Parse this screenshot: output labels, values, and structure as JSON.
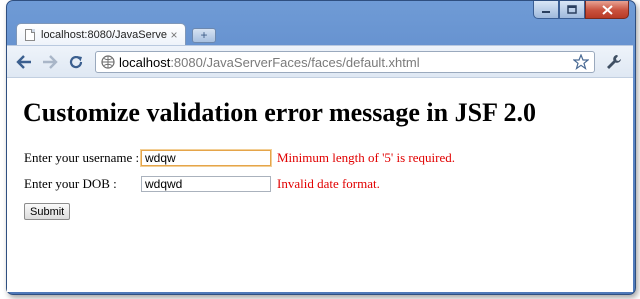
{
  "window": {
    "controls": {
      "minimize_icon": "minimize-icon",
      "maximize_icon": "maximize-icon",
      "close_icon": "close-icon"
    },
    "accent_color": "#5b86c6"
  },
  "tabs": [
    {
      "title": "localhost:8080/JavaServer...",
      "close": "×"
    }
  ],
  "new_tab_label": "+",
  "toolbar": {
    "url_host": "localhost",
    "url_rest": ":8080/JavaServerFaces/faces/default.xhtml"
  },
  "page": {
    "heading": "Customize validation error message in JSF 2.0",
    "form": {
      "username": {
        "label": "Enter your username :",
        "value": "wdqw",
        "error": "Minimum length of '5' is required."
      },
      "dob": {
        "label": "Enter your DOB :",
        "value": "wdqwd",
        "error": "Invalid date format."
      },
      "submit_label": "Submit"
    },
    "error_color": "#e10000"
  }
}
